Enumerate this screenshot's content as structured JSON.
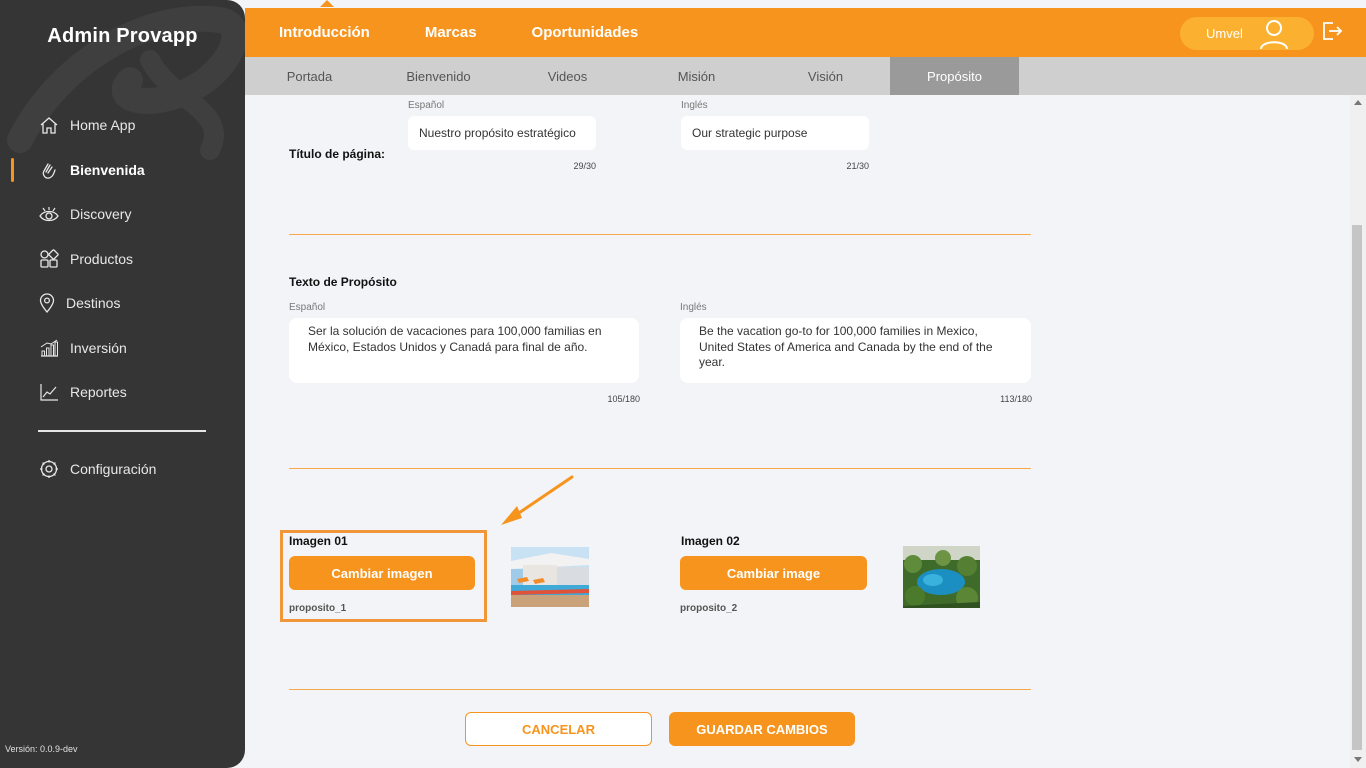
{
  "sidebar": {
    "brand": "Admin Provapp",
    "items": [
      {
        "label": "Home App",
        "icon": "home-icon"
      },
      {
        "label": "Bienvenida",
        "icon": "waving-hand-icon",
        "active": true
      },
      {
        "label": "Discovery",
        "icon": "eye-icon"
      },
      {
        "label": "Productos",
        "icon": "grid-icon"
      },
      {
        "label": "Destinos",
        "icon": "location-pin-icon"
      },
      {
        "label": "Inversión",
        "icon": "bar-chart-icon"
      },
      {
        "label": "Reportes",
        "icon": "line-chart-icon"
      }
    ],
    "config_label": "Configuración",
    "version": "Versión: 0.0.9-dev"
  },
  "topbar": {
    "tabs": [
      "Introducción",
      "Marcas",
      "Oportunidades"
    ],
    "user_name": "Umvel"
  },
  "subtabs": [
    {
      "label": "Portada"
    },
    {
      "label": "Bienvenido"
    },
    {
      "label": "Videos"
    },
    {
      "label": "Misión"
    },
    {
      "label": "Visión"
    },
    {
      "label": "Propósito",
      "active": true
    }
  ],
  "page_title_section": {
    "label": "Título de página:",
    "es_label": "Español",
    "en_label": "Inglés",
    "es_value": "Nuestro propósito estratégico",
    "en_value": "Our strategic purpose",
    "es_count": "29/30",
    "en_count": "21/30"
  },
  "purpose_section": {
    "label": "Texto de Propósito",
    "es_label": "Español",
    "en_label": "Inglés",
    "es_value": "Ser la solución de vacaciones para 100,000 familias en México, Estados Unidos y Canadá para final de año.",
    "en_value": "Be the vacation go-to for 100,000 families in Mexico, United States of America and Canada by the end of the year.",
    "es_count": "105/180",
    "en_count": "113/180"
  },
  "images": {
    "image1": {
      "label": "Imagen 01",
      "button": "Cambiar imagen",
      "file": "proposito_1"
    },
    "image2": {
      "label": "Imagen 02",
      "button": "Cambiar image",
      "file": "proposito_2"
    }
  },
  "actions": {
    "cancel": "CANCELAR",
    "save": "GUARDAR CAMBIOS"
  },
  "colors": {
    "accent": "#f7941d",
    "sidebar_bg": "#353535",
    "subtabs_bg": "#cfcfcf",
    "subtab_active": "#9a9a9a",
    "page_bg": "#f3f4f7"
  }
}
